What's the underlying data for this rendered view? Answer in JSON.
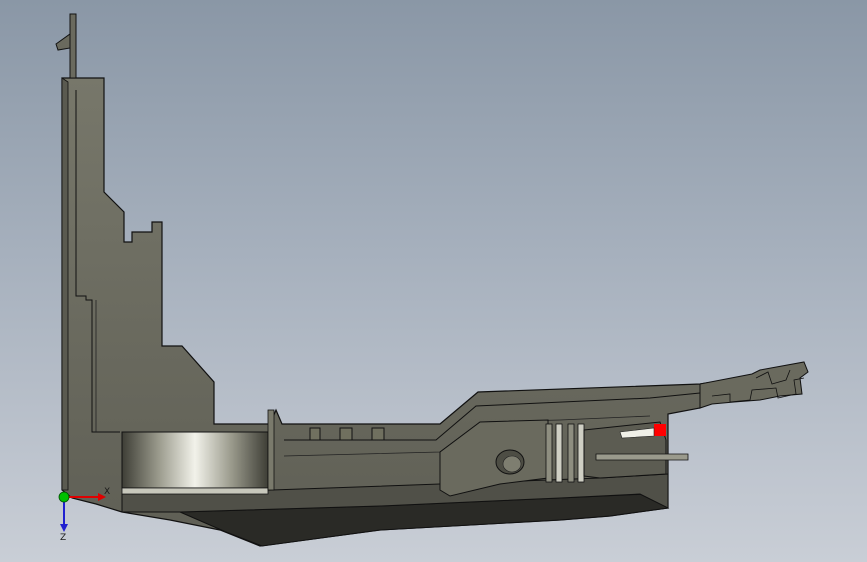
{
  "viewport": {
    "background_top": "#8a97a6",
    "background_bottom": "#c9ced6"
  },
  "part": {
    "body_color": "#6e6e62",
    "body_dark": "#4a4a42",
    "edge_color": "#111111",
    "highlight_color": "#e8e8e0",
    "accent_red": "#ff0000"
  },
  "triad": {
    "x_label": "X",
    "z_label": "Z",
    "x_color": "#e00000",
    "y_color": "#00c000",
    "z_color": "#2020d0"
  }
}
